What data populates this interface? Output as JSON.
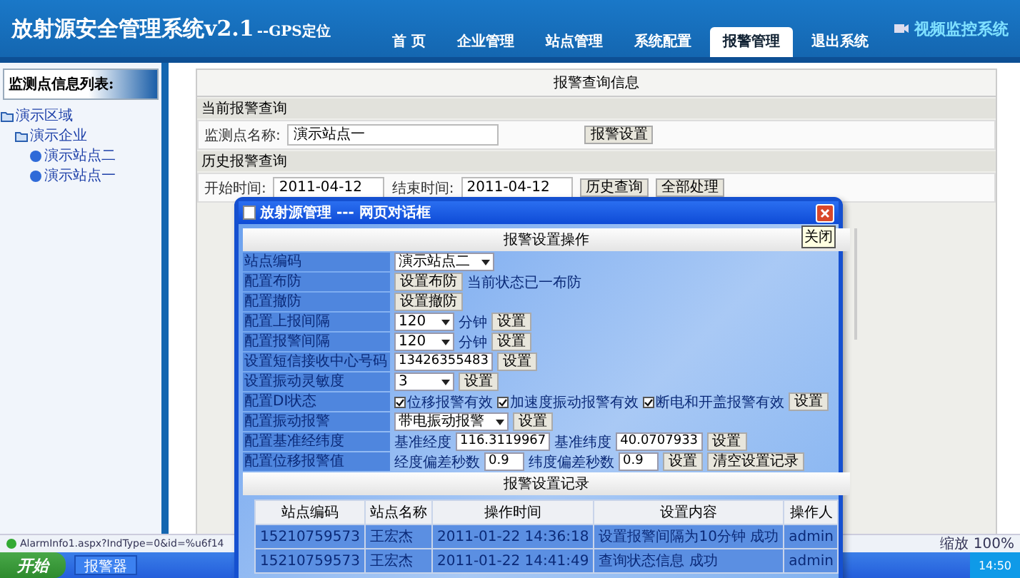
{
  "header": {
    "title": "放射源安全管理系统v2.1",
    "subtitle": "--GPS定位",
    "nav": [
      {
        "label": "首 页",
        "selected": false
      },
      {
        "label": "企业管理",
        "selected": false
      },
      {
        "label": "站点管理",
        "selected": false
      },
      {
        "label": "系统配置",
        "selected": false
      },
      {
        "label": "报警管理",
        "selected": true
      },
      {
        "label": "退出系统",
        "selected": false
      }
    ],
    "logo": "视频监控系统"
  },
  "sidebar": {
    "title": "监测点信息列表:",
    "tree": [
      {
        "label": "演示区域",
        "children": [
          {
            "label": "演示企业",
            "children": [
              {
                "label": "演示站点二"
              },
              {
                "label": "演示站点一"
              }
            ]
          }
        ]
      }
    ]
  },
  "query": {
    "title": "报警查询信息",
    "current_section": "当前报警查询",
    "station_label": "监测点名称:",
    "station_value": "演示站点一",
    "settings_button": "报警设置",
    "history_section": "历史报警查询",
    "start_label": "开始时间:",
    "start_value": "2011-04-12",
    "end_label": "结束时间:",
    "end_value": "2011-04-12",
    "buttons": [
      "历史查询",
      "全部处理"
    ]
  },
  "dialog": {
    "title": "放射源管理 --- 网页对话框",
    "close_tooltip": "关闭",
    "section": "报警设置操作",
    "rows": [
      {
        "label": "站点编码",
        "controls": [
          {
            "kind": "select",
            "value": "演示站点二"
          }
        ]
      },
      {
        "label": "配置布防",
        "controls": [
          {
            "kind": "button",
            "label": "设置布防"
          },
          {
            "kind": "text",
            "text": "当前状态已一布防"
          }
        ]
      },
      {
        "label": "配置撤防",
        "controls": [
          {
            "kind": "button",
            "label": "设置撤防"
          }
        ]
      },
      {
        "label": "配置上报间隔",
        "controls": [
          {
            "kind": "select",
            "value": "120"
          },
          {
            "kind": "text",
            "text": "分钟"
          },
          {
            "kind": "button",
            "label": "设置"
          }
        ]
      },
      {
        "label": "配置报警间隔",
        "controls": [
          {
            "kind": "select",
            "value": "120"
          },
          {
            "kind": "text",
            "text": "分钟"
          },
          {
            "kind": "button",
            "label": "设置"
          }
        ]
      },
      {
        "label": "设置短信接收中心号码",
        "controls": [
          {
            "kind": "input",
            "value": "13426355483"
          },
          {
            "kind": "button",
            "label": "设置"
          }
        ]
      },
      {
        "label": "设置振动灵敏度",
        "controls": [
          {
            "kind": "select",
            "value": "3"
          },
          {
            "kind": "button",
            "label": "设置"
          }
        ]
      },
      {
        "label": "配置DI状态",
        "controls": [
          {
            "kind": "checkbox",
            "label": "位移报警有效",
            "checked": true
          },
          {
            "kind": "checkbox",
            "label": "加速度振动报警有效",
            "checked": true
          },
          {
            "kind": "checkbox",
            "label": "断电和开盖报警有效",
            "checked": true
          },
          {
            "kind": "button",
            "label": "设置"
          }
        ]
      },
      {
        "label": "配置振动报警",
        "controls": [
          {
            "kind": "select",
            "value": "带电振动报警"
          },
          {
            "kind": "button",
            "label": "设置"
          }
        ]
      },
      {
        "label": "配置基准经纬度",
        "controls": [
          {
            "kind": "text",
            "text": "基准经度"
          },
          {
            "kind": "input",
            "value": "116.3119967"
          },
          {
            "kind": "text",
            "text": "基准纬度"
          },
          {
            "kind": "input",
            "value": "40.0707933"
          },
          {
            "kind": "button",
            "label": "设置"
          }
        ]
      },
      {
        "label": "配置位移报警值",
        "controls": [
          {
            "kind": "text",
            "text": "经度偏差秒数"
          },
          {
            "kind": "input",
            "value": "0.9"
          },
          {
            "kind": "text",
            "text": "纬度偏差秒数"
          },
          {
            "kind": "input",
            "value": "0.9"
          },
          {
            "kind": "button",
            "label": "设置"
          },
          {
            "kind": "button",
            "label": "清空设置记录"
          }
        ]
      }
    ],
    "log_section": "报警设置记录",
    "log_columns": [
      "站点编码",
      "站点名称",
      "操作时间",
      "设置内容",
      "操作人"
    ],
    "log_rows": [
      [
        "15210759573",
        "王宏杰",
        "2011-01-22 14:36:18",
        "设置报警间隔为10分钟 成功",
        "admin"
      ],
      [
        "15210759573",
        "王宏杰",
        "2011-01-22 14:41:49",
        "查询状态信息 成功",
        "admin"
      ]
    ]
  },
  "status_bar": {
    "url": "AlarmInfo1.aspx?IndType=0&id=%u6f14",
    "zoom": "缩放 100%"
  },
  "taskbar": {
    "start": "开始",
    "task": "报警器",
    "clock": "14:50"
  }
}
